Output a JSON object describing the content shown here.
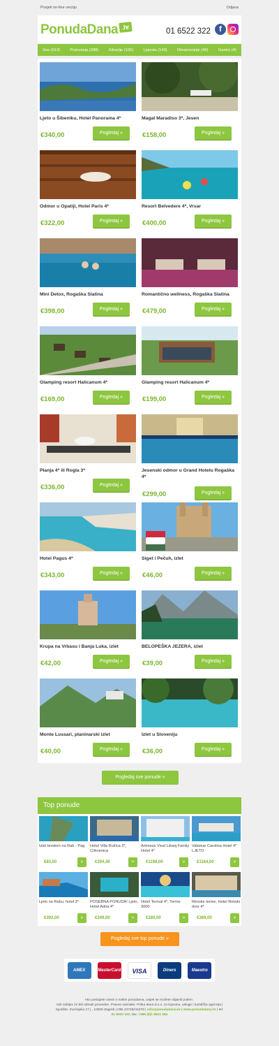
{
  "topbar": {
    "online_link": "Posjeti on-line verziju",
    "unsubscribe": "Odjava"
  },
  "header": {
    "logo_text": "PonudaDana",
    "logo_tld": ".hr",
    "phone": "01 6522 322",
    "fb_letter": "f"
  },
  "nav": [
    "Sve (613)",
    "Putovanja (288)",
    "Zdravlje (105)",
    "Ljepota (143)",
    "Obrazovanje (49)",
    "Gastro (4)"
  ],
  "offers": [
    {
      "title": "Ljeto u Šibeniku, Hotel Panorama 4*",
      "price": "€340,00",
      "button": "Pogledaj »"
    },
    {
      "title": "Magal Maradiso 3*, Jesen",
      "price": "€158,00",
      "button": "Pogledaj »"
    },
    {
      "title": "Odmor u Opatiji, Hotel Paris 4*",
      "price": "€322,00",
      "button": "Pogledaj »"
    },
    {
      "title": "Resort Belvedere 4*, Vrsar",
      "price": "€400,00",
      "button": "Pogledaj »"
    },
    {
      "title": "Mini Detox, Rogaška Slatina",
      "price": "€398,00",
      "button": "Pogledaj »"
    },
    {
      "title": "Romantično wellness, Rogaška Slatina",
      "price": "€479,00",
      "button": "Pogledaj »"
    },
    {
      "title": "Glamping resort Halicanum 4*",
      "price": "€169,00",
      "button": "Pogledaj »"
    },
    {
      "title": "Glamping resort Halicanum 4*",
      "price": "€199,00",
      "button": "Pogledaj »"
    },
    {
      "title": "Planja 4* ili Rogla 3*",
      "price": "€336,00",
      "button": "Pogledaj »"
    },
    {
      "title": "Jesenski odmor u Grand Hotelu Rogaška 4*",
      "price": "€299,00",
      "button": "Pogledaj »"
    },
    {
      "title": "Hotel Pagus 4*",
      "price": "€343,00",
      "button": "Pogledaj »"
    },
    {
      "title": "Siget i Pečuh, izlet",
      "price": "€46,00",
      "button": "Pogledaj »"
    },
    {
      "title": "Krupa na Vrbasu i Banja Luka, izlet",
      "price": "€42,00",
      "button": "Pogledaj »"
    },
    {
      "title": "BELOPEŠKA JEZERA, izlet",
      "price": "€39,00",
      "button": "Pogledaj »"
    },
    {
      "title": "Monte Lussari, planinarski izlet",
      "price": "€40,00",
      "button": "Pogledaj »"
    },
    {
      "title": "Izlet u Sloveniju",
      "price": "€36,00",
      "button": "Pogledaj »"
    }
  ],
  "all_offers_button": "Pogledaj sve ponude »",
  "top_section": {
    "heading": "Top ponude"
  },
  "top_offers": [
    {
      "title": "Izlet brodom na Rab - Pag",
      "price": "€83,00",
      "button": "»"
    },
    {
      "title": "Hotel Villa Ružica 3*, Crikvenica",
      "price": "€294,40",
      "button": "»"
    },
    {
      "title": "Aminess Vival Lišanj Family Hotel 4*",
      "price": "€1198,00",
      "button": "»"
    },
    {
      "title": "Valamar Carolina Hotel 4* LJETO",
      "price": "€1164,00",
      "button": "»"
    },
    {
      "title": "Ljeto na Rabu, hotel 3*",
      "price": "€392,00",
      "button": "»"
    },
    {
      "title": "POSEBNA PONUDA! Ljeto, Hotel Adria 4*",
      "price": "€349,00",
      "button": "»"
    },
    {
      "title": "Hotel Termal 4*, Terme 3000",
      "price": "€280,00",
      "button": "»"
    },
    {
      "title": "Rimske terme, Hotel Rimski dvor 4*",
      "price": "€389,00",
      "button": "»"
    }
  ],
  "top_offers_button": "Pogledaj sve top ponude »",
  "payments": [
    {
      "label": "AMEX",
      "color": "#2e77bb"
    },
    {
      "label": "MasterCard",
      "color": "#c8102e"
    },
    {
      "label": "VISA",
      "color": "#ffffff"
    },
    {
      "label": "Diners",
      "color": "#0a3b7d"
    },
    {
      "label": "Maestro",
      "color": "#1a3a8f"
    }
  ],
  "footer": {
    "line1": "Ako postajete ovisni o našim ponudama, uvijek se možete odjaviti putem .",
    "line2": "Vaš zahtjev će biti odmah proveden. Pravne naznake. Priika dana d.o.o. za trgovinu, usluge i turistička agencija |",
    "line3a": "Sjedište: Zvečajska 17 | , 10000 Zagreb | OIB 43728211079 |",
    "email": "info@ponudadana.hr",
    "sep": "|",
    "site": "www.ponudadana.hr",
    "tel_label": "| tel:",
    "phone1": "01 6522 322,",
    "fax_label": "fax:",
    "phone2": "+385 (0)1 6522 264"
  }
}
